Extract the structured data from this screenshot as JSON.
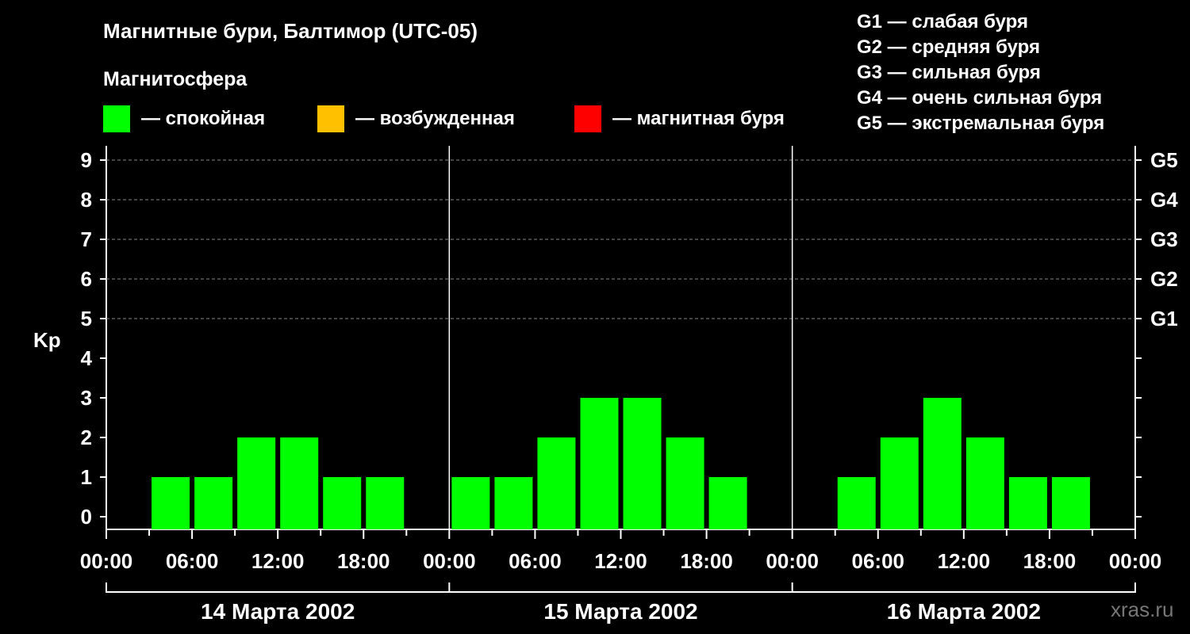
{
  "header": {
    "title": "Магнитные бури, Балтимор (UTC-05)",
    "subtitle": "Магнитосфера"
  },
  "legend": [
    {
      "label": "— спокойная",
      "color": "#00ff00"
    },
    {
      "label": "— возбужденная",
      "color": "#ffc000"
    },
    {
      "label": "— магнитная буря",
      "color": "#ff0000"
    }
  ],
  "storm_scale": [
    "G1 — слабая буря",
    "G2 — средняя буря",
    "G3 — сильная буря",
    "G4 — очень сильная буря",
    "G5 — экстремальная буря"
  ],
  "watermark": "xras.ru",
  "chart_data": {
    "type": "bar",
    "title": "Магнитные бури, Балтимор (UTC-05)",
    "ylabel": "Kp",
    "ylim": [
      0,
      9
    ],
    "yticks": [
      "0",
      "1",
      "2",
      "3",
      "4",
      "5",
      "6",
      "7",
      "8",
      "9"
    ],
    "right_ticks": [
      {
        "kp": 5,
        "label": "G1"
      },
      {
        "kp": 6,
        "label": "G2"
      },
      {
        "kp": 7,
        "label": "G3"
      },
      {
        "kp": 8,
        "label": "G4"
      },
      {
        "kp": 9,
        "label": "G5"
      }
    ],
    "xtick_labels": [
      "00:00",
      "06:00",
      "12:00",
      "18:00",
      "00:00",
      "06:00",
      "12:00",
      "18:00",
      "00:00",
      "06:00",
      "12:00",
      "18:00",
      "00:00"
    ],
    "grid": "dashed horizontal at Kp 5–9",
    "days": [
      {
        "label": "14 Марта 2002",
        "values": [
          0,
          1,
          1,
          2,
          2,
          1,
          1,
          0
        ]
      },
      {
        "label": "15 Марта 2002",
        "values": [
          1,
          1,
          2,
          3,
          3,
          2,
          1,
          0
        ]
      },
      {
        "label": "16 Марта 2002",
        "values": [
          0,
          1,
          2,
          3,
          2,
          1,
          1,
          0
        ]
      }
    ],
    "bar_interval_hours": 3,
    "bar_color": "#00ff00"
  }
}
